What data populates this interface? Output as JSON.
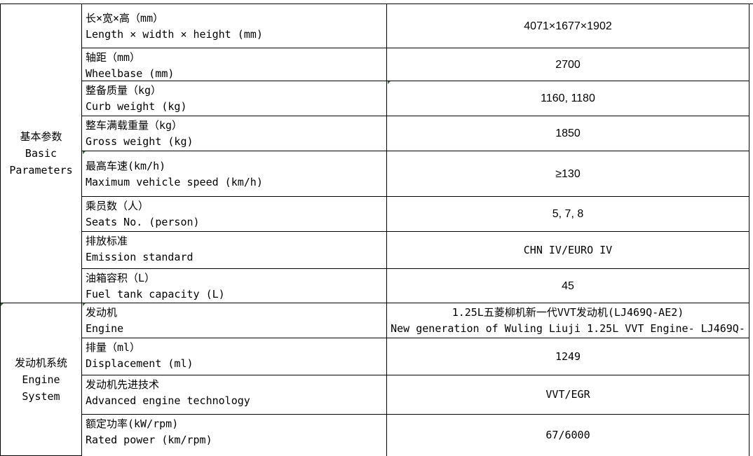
{
  "sections": {
    "basic": {
      "cn": "基本参数",
      "en1": "Basic",
      "en2": "Parameters"
    },
    "engine": {
      "cn": "发动机系统",
      "en1": "Engine",
      "en2": "System"
    }
  },
  "rows": [
    {
      "cn": "长×宽×高（mm）",
      "en": "Length × width × height (mm)",
      "value": "4071×1677×1902"
    },
    {
      "cn": "轴距（mm）",
      "en": "Wheelbase (mm)",
      "value": "2700"
    },
    {
      "cn": "整备质量（kg）",
      "en": "Curb weight (kg)",
      "value": "1160, 1180"
    },
    {
      "cn": "整车满载重量（kg）",
      "en": "Gross weight (kg)",
      "value": "1850"
    },
    {
      "cn": "最高车速(km/h)",
      "en": "Maximum vehicle speed (km/h)",
      "value": "≥130"
    },
    {
      "cn": "乘员数（人）",
      "en": "Seats No. (person)",
      "value": "5, 7, 8"
    },
    {
      "cn": "排放标准",
      "en": "Emission standard",
      "value": "CHN IV/EURO IV"
    },
    {
      "cn": "油箱容积（L）",
      "en": "Fuel tank capacity (L)",
      "value": "45"
    },
    {
      "cn": "发动机",
      "en": "Engine",
      "value": "1.25L五菱柳机新一代VVT发动机(LJ469Q-AE2)",
      "value2": "New generation of Wuling Liuji 1.25L VVT Engine- LJ469Q-"
    },
    {
      "cn": "排量（ml）",
      "en": "Displacement (ml)",
      "value": "1249"
    },
    {
      "cn": "发动机先进技术",
      "en": "Advanced engine technology",
      "value": "VVT/EGR"
    },
    {
      "cn": "额定功率(kW/rpm)",
      "en": "Rated power (km/rpm)",
      "value": "67/6000"
    }
  ],
  "colors": {
    "grid": "#000000",
    "marker": "#1e7a1e"
  }
}
